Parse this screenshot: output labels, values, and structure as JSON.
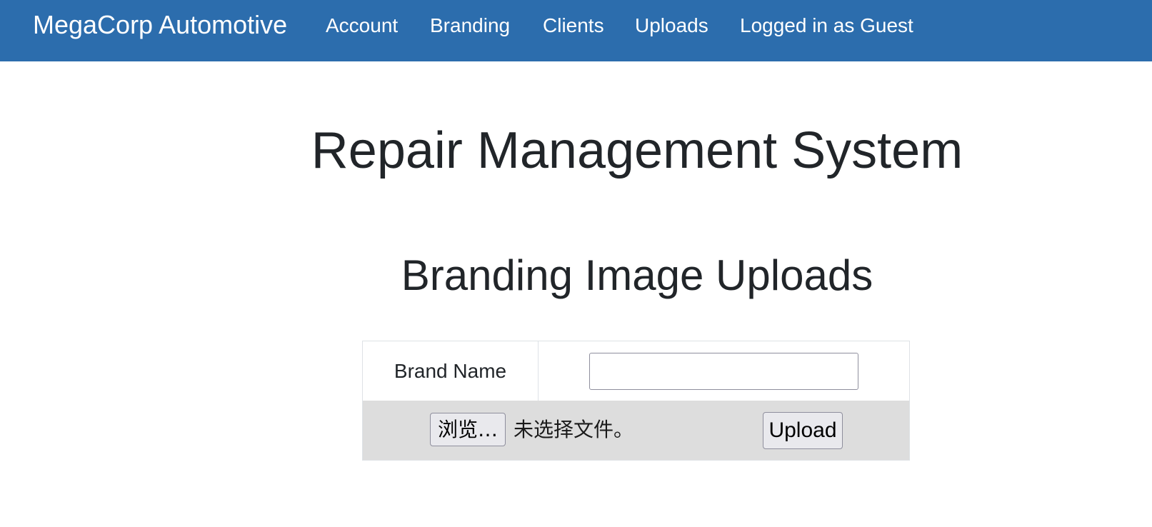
{
  "navbar": {
    "brand": "MegaCorp Automotive",
    "links": [
      "Account",
      "Branding",
      "Clients",
      "Uploads"
    ],
    "user_status": "Logged in as Guest",
    "background_color": "#2c6dad"
  },
  "main": {
    "title": "Repair Management System",
    "section_title": "Branding Image Uploads"
  },
  "form": {
    "brand_name_label": "Brand Name",
    "brand_name_value": "",
    "browse_label": "浏览…",
    "file_status": "未选择文件。",
    "upload_label": "Upload"
  }
}
